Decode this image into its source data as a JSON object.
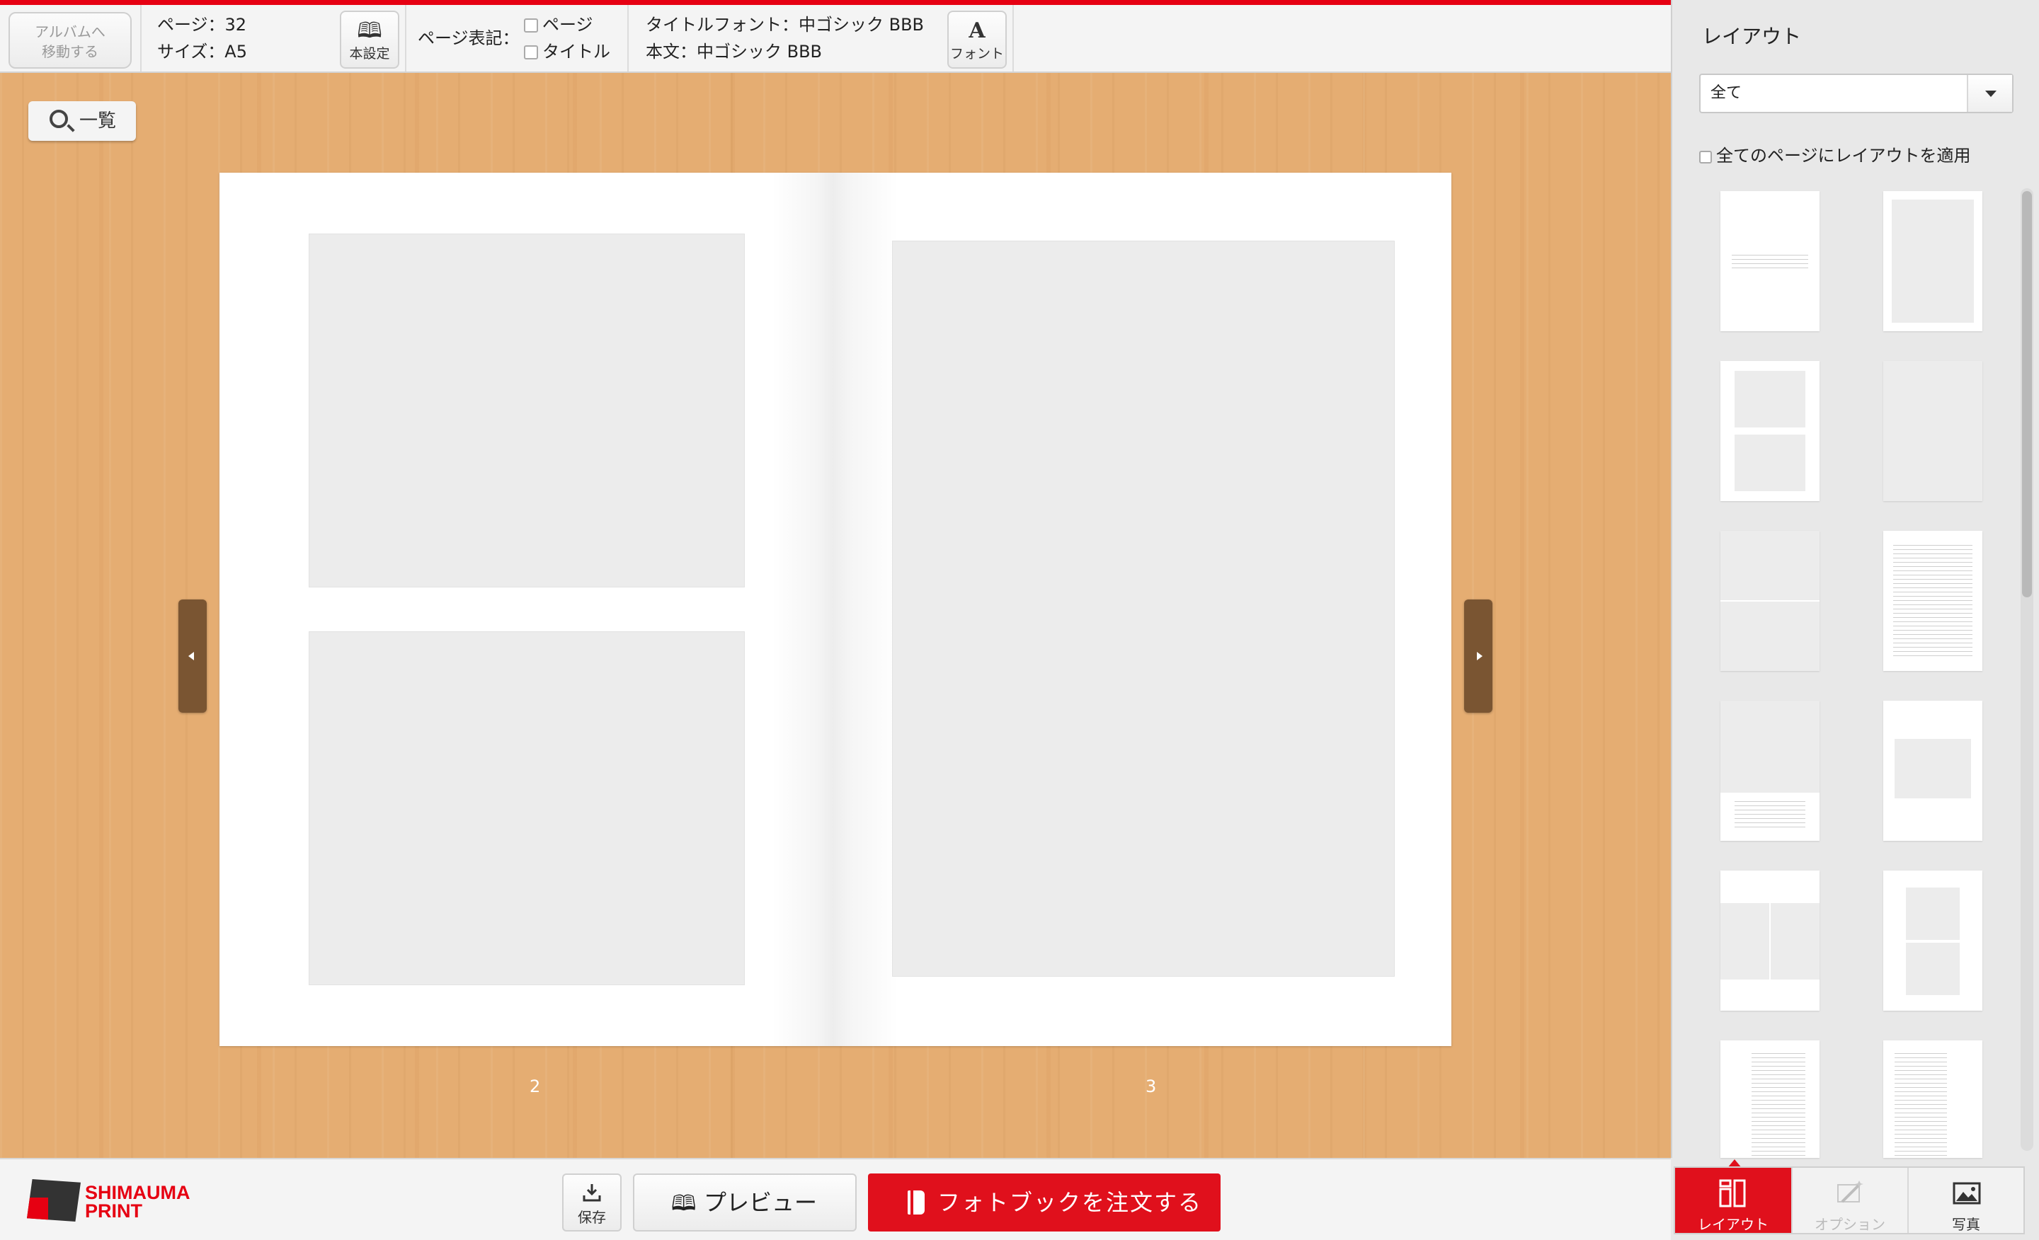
{
  "toolbar": {
    "back_label": "アルバムへ 移動する",
    "pages_label": "ページ：32",
    "size_label": "サイズ：A5",
    "basic_settings_label": "本設定",
    "page_notation_label": "ページ表記：",
    "page_checkbox_label": "ページ",
    "title_checkbox_label": "タイトル",
    "title_font_label": "タイトルフォント：中ゴシック BBB",
    "body_font_label": "本文：中ゴシック BBB",
    "font_button_label": "フォント",
    "font_icon": "A"
  },
  "workspace": {
    "list_button_label": "一覧",
    "left_page_number": "2",
    "right_page_number": "3"
  },
  "bottom": {
    "logo_line1": "SHIMAUMA",
    "logo_line2": "PRINT",
    "save_label": "保存",
    "preview_label": "プレビュー",
    "order_label": "フォトブックを注文する"
  },
  "panel": {
    "title": "レイアウト",
    "filter_value": "全て",
    "apply_all_label": "全てのページにレイアウトを適用",
    "tabs": [
      {
        "label": "レイアウト",
        "state": "active"
      },
      {
        "label": "オプション",
        "state": "disabled"
      },
      {
        "label": "写真",
        "state": "normal"
      }
    ]
  },
  "colors": {
    "accent": "#e60012",
    "desk": "#e5ad72",
    "page_handle": "#7a5532"
  }
}
